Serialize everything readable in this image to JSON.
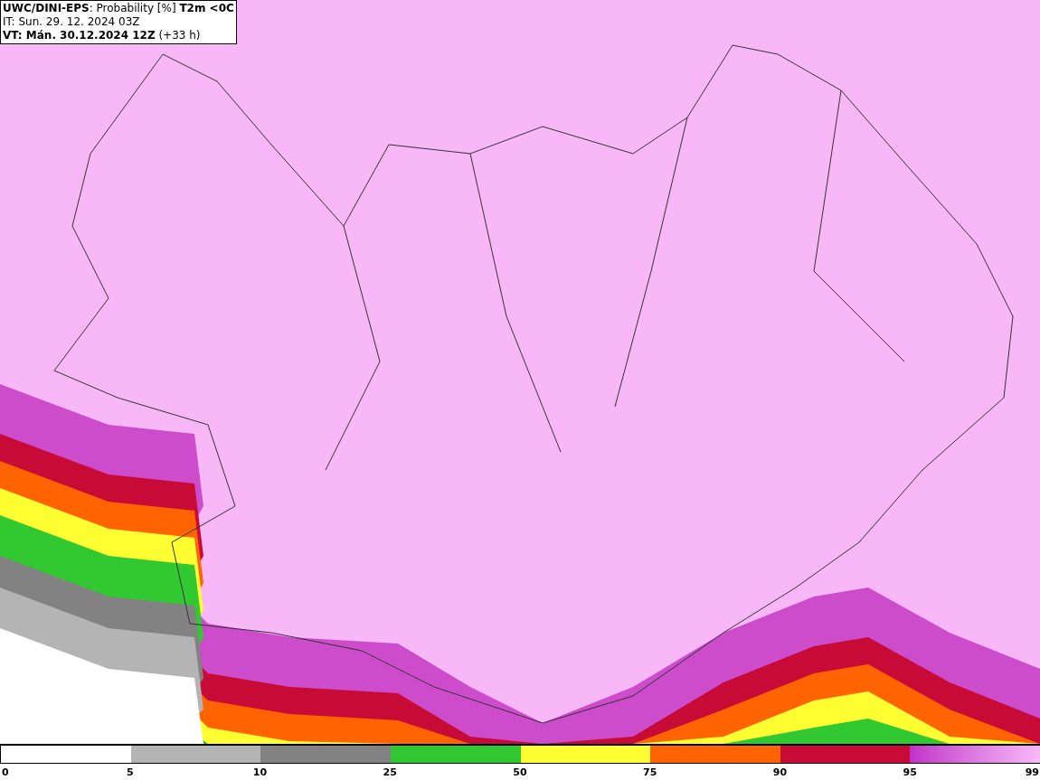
{
  "header": {
    "lines": [
      "**UWC/DINI-EPS**: Probability [%] **T2m <0C**",
      "IT: Sun. 29. 12. 2024 03Z",
      "**VT: Mán. 30.12.2024 12Z** (+33 h)"
    ]
  },
  "legend": {
    "bands": [
      {
        "kind": "solid",
        "color": "#ffffff"
      },
      {
        "kind": "solid",
        "color": "#b4b4b4"
      },
      {
        "kind": "solid",
        "color": "#828282"
      },
      {
        "kind": "solid",
        "color": "#32c832"
      },
      {
        "kind": "solid",
        "color": "#ffff32"
      },
      {
        "kind": "solid",
        "color": "#ff6400"
      },
      {
        "kind": "solid",
        "color": "#c80a37"
      },
      {
        "kind": "gradient"
      }
    ],
    "labels": [
      "0",
      "5",
      "10",
      "25",
      "50",
      "75",
      "90",
      "95",
      "99"
    ]
  }
}
